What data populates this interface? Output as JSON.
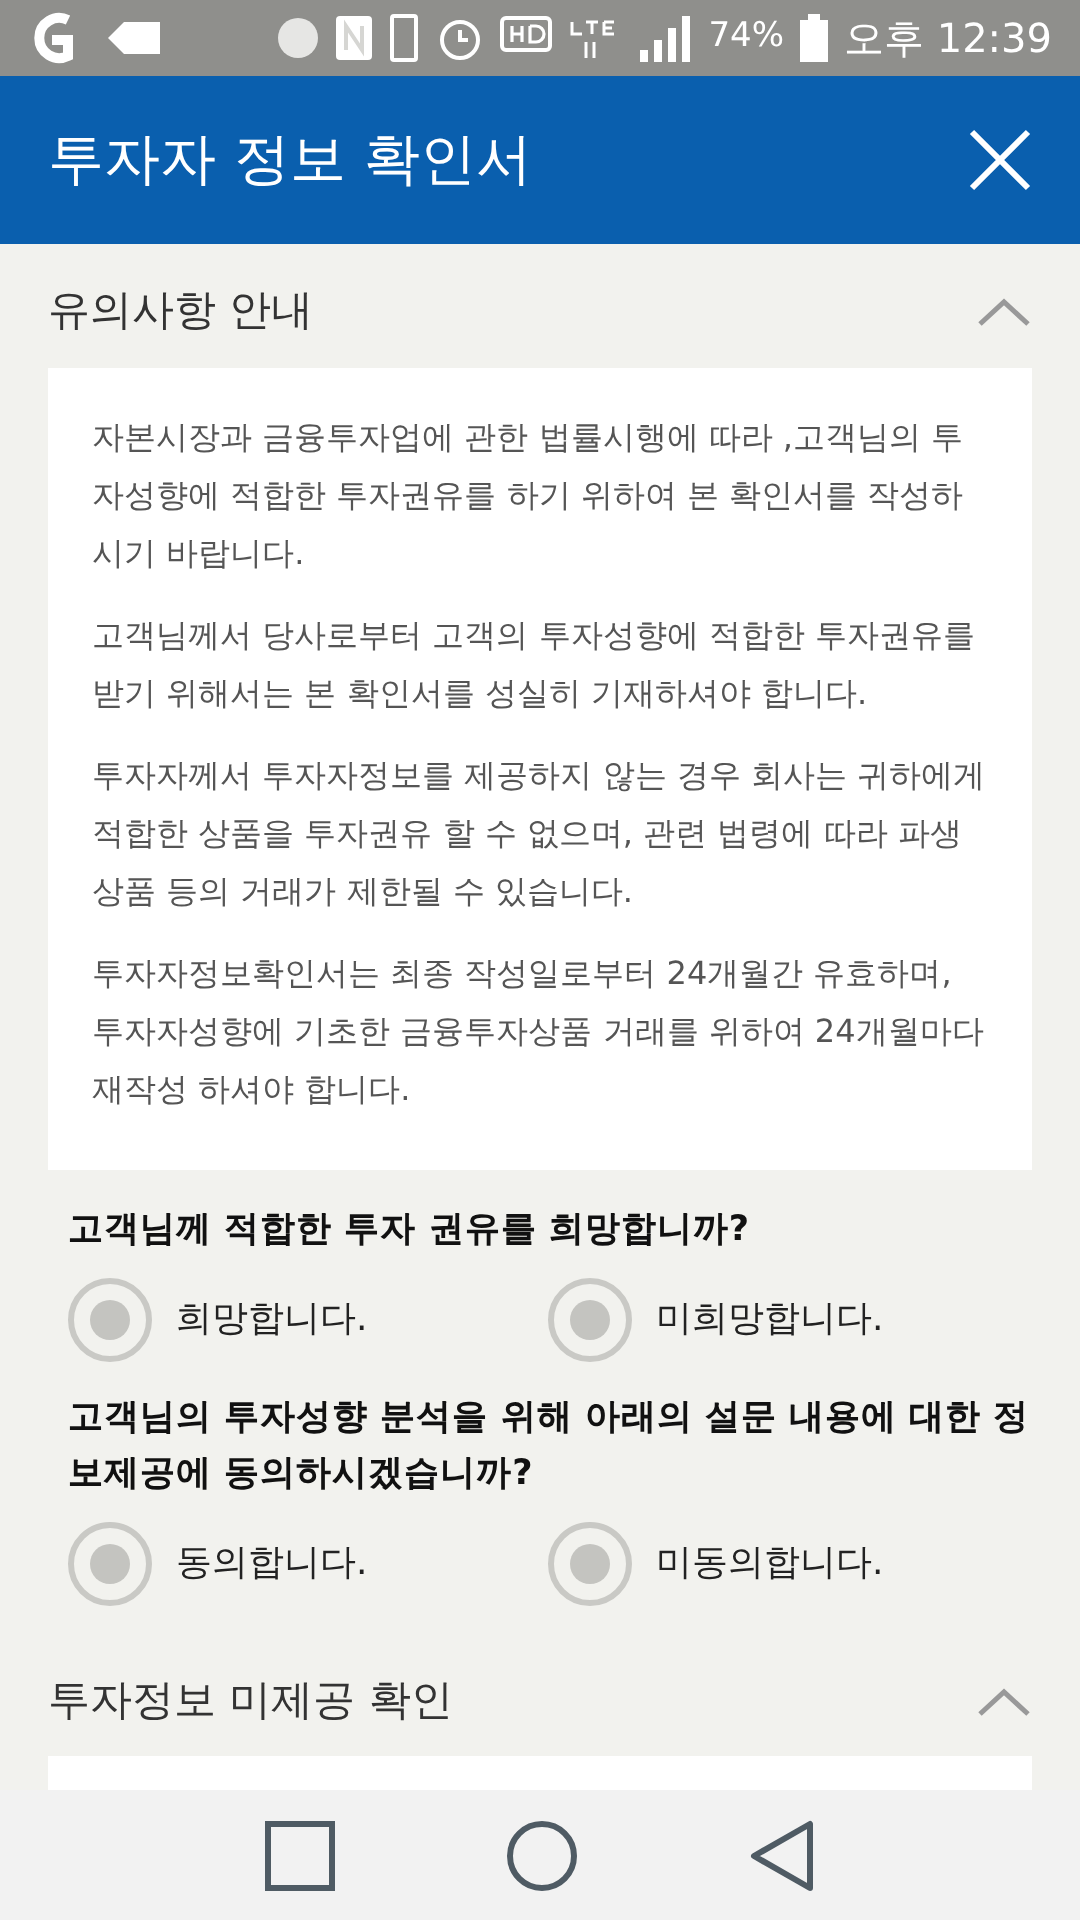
{
  "status_bar": {
    "battery": "74%",
    "time": "오후 12:39"
  },
  "header": {
    "title": "투자자 정보 확인서"
  },
  "sections": [
    {
      "title": "유의사항 안내",
      "expanded": true,
      "paragraphs": [
        "자본시장과 금융투자업에 관한 법률시행에 따라 ,고객님의 투자성향에 적합한 투자권유를 하기 위하여 본 확인서를 작성하시기 바랍니다.",
        "고객님께서 당사로부터 고객의 투자성향에 적합한 투자권유를 받기 위해서는 본 확인서를 성실히 기재하셔야 합니다.",
        "투자자께서 투자자정보를 제공하지 않는 경우 회사는 귀하에게 적합한 상품을 투자권유 할 수 없으며, 관련 법령에 따라 파생상품 등의 거래가 제한될 수 있습니다.",
        "투자자정보확인서는 최종 작성일로부터 24개월간 유효하며, 투자자성향에 기초한 금융투자상품 거래를 위하여 24개월마다 재작성 하셔야 합니다."
      ],
      "questions": [
        {
          "text": "고객님께 적합한 투자 권유를 희망합니까?",
          "options": [
            {
              "label": "희망합니다.",
              "selected": false
            },
            {
              "label": "미희망합니다.",
              "selected": false
            }
          ]
        },
        {
          "text": "고객님의 투자성향 분석을 위해 아래의 설문 내용에 대한 정보제공에 동의하시겠습니까?",
          "options": [
            {
              "label": "동의합니다.",
              "selected": false
            },
            {
              "label": "미동의합니다.",
              "selected": false
            }
          ]
        }
      ]
    },
    {
      "title": "투자정보 미제공 확인",
      "expanded": true
    }
  ]
}
